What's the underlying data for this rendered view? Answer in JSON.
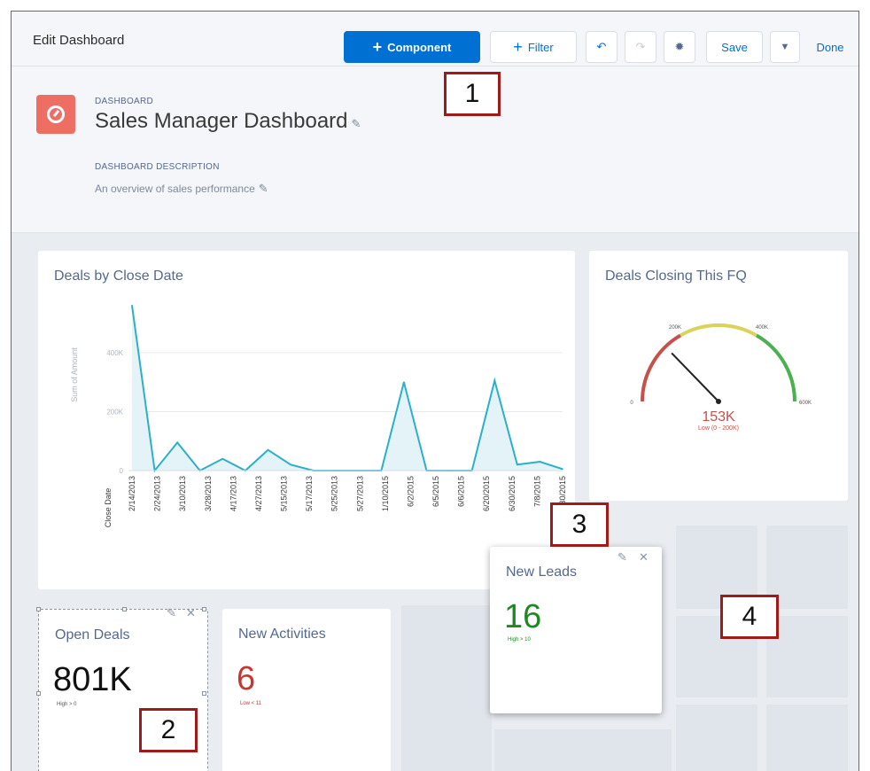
{
  "toolbar": {
    "title": "Edit Dashboard",
    "component_label": "Component",
    "filter_label": "Filter",
    "save_label": "Save",
    "done_label": "Done"
  },
  "header": {
    "kicker": "DASHBOARD",
    "title": "Sales Manager Dashboard",
    "description_kicker": "DASHBOARD DESCRIPTION",
    "description": "An overview of sales performance"
  },
  "cards": {
    "deals_by_close_date": {
      "title": "Deals by Close Date"
    },
    "deals_closing_fq": {
      "title": "Deals Closing This FQ",
      "value": "153K",
      "range_text": "Low (0 - 200K)"
    },
    "open_deals": {
      "title": "Open Deals",
      "value": "801K",
      "sub": "High > 0"
    },
    "new_activities": {
      "title": "New Activities",
      "value": "6",
      "sub": "Low < 11"
    },
    "new_leads": {
      "title": "New Leads",
      "value": "16",
      "sub": "High > 10"
    }
  },
  "callouts": [
    "1",
    "2",
    "3",
    "4"
  ],
  "colors": {
    "brand": "#0070d2",
    "icon_bg": "#ef6e64",
    "line": "#2bb0c8",
    "leads_green": "#1c8a21",
    "activities_red": "#c23934"
  },
  "chart_data": [
    {
      "type": "area",
      "ylabel": "Sum of Amount",
      "xlabel": "Close Date",
      "ylim": [
        0,
        580000
      ],
      "yticks": [
        {
          "value": 0,
          "label": "0"
        },
        {
          "value": 200000,
          "label": "200K"
        },
        {
          "value": 400000,
          "label": "400K"
        }
      ],
      "categories": [
        "2/14/2013",
        "2/24/2013",
        "3/10/2013",
        "3/28/2013",
        "4/17/2013",
        "4/27/2013",
        "5/15/2013",
        "5/17/2013",
        "5/25/2013",
        "5/27/2013",
        "1/10/2015",
        "6/2/2015",
        "6/5/2015",
        "6/6/2015",
        "6/20/2015",
        "6/30/2015",
        "7/8/2015",
        "7/30/2015"
      ],
      "values": [
        560000,
        0,
        95000,
        0,
        40000,
        0,
        70000,
        20000,
        0,
        0,
        0,
        0,
        300000,
        0,
        0,
        0,
        305000,
        20000,
        30000,
        5000
      ],
      "grid": true
    },
    {
      "type": "gauge",
      "min": 0,
      "max": 600000,
      "value": 153000,
      "breakpoints": [
        200000,
        400000
      ],
      "tick_labels": [
        "0",
        "200K",
        "400K",
        "600K"
      ]
    }
  ]
}
